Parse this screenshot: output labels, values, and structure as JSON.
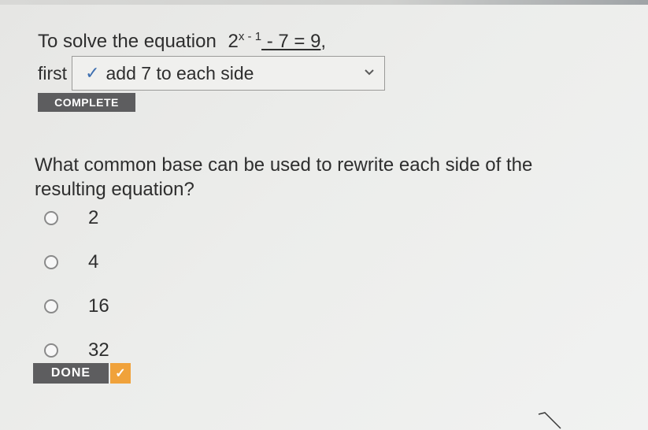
{
  "problem": {
    "intro": "To solve the equation",
    "equation": {
      "base": "2",
      "exponent": "x - 1",
      "rest": " - 7 = 9",
      "trailing": ","
    },
    "first_label": "first",
    "dropdown": {
      "check": "✓",
      "selected": "add 7 to each side",
      "chevron_icon": "chevron-down-icon"
    },
    "complete_label": "COMPLETE"
  },
  "question": {
    "text": "What common base can be used to rewrite each side of the resulting equation?",
    "options": [
      "2",
      "4",
      "16",
      "32"
    ]
  },
  "done": {
    "label": "DONE",
    "check": "✓",
    "accent_color": "#f0a23b"
  },
  "colors": {
    "badge_bg": "#5d5d5f",
    "check_blue": "#3e6fb0"
  }
}
